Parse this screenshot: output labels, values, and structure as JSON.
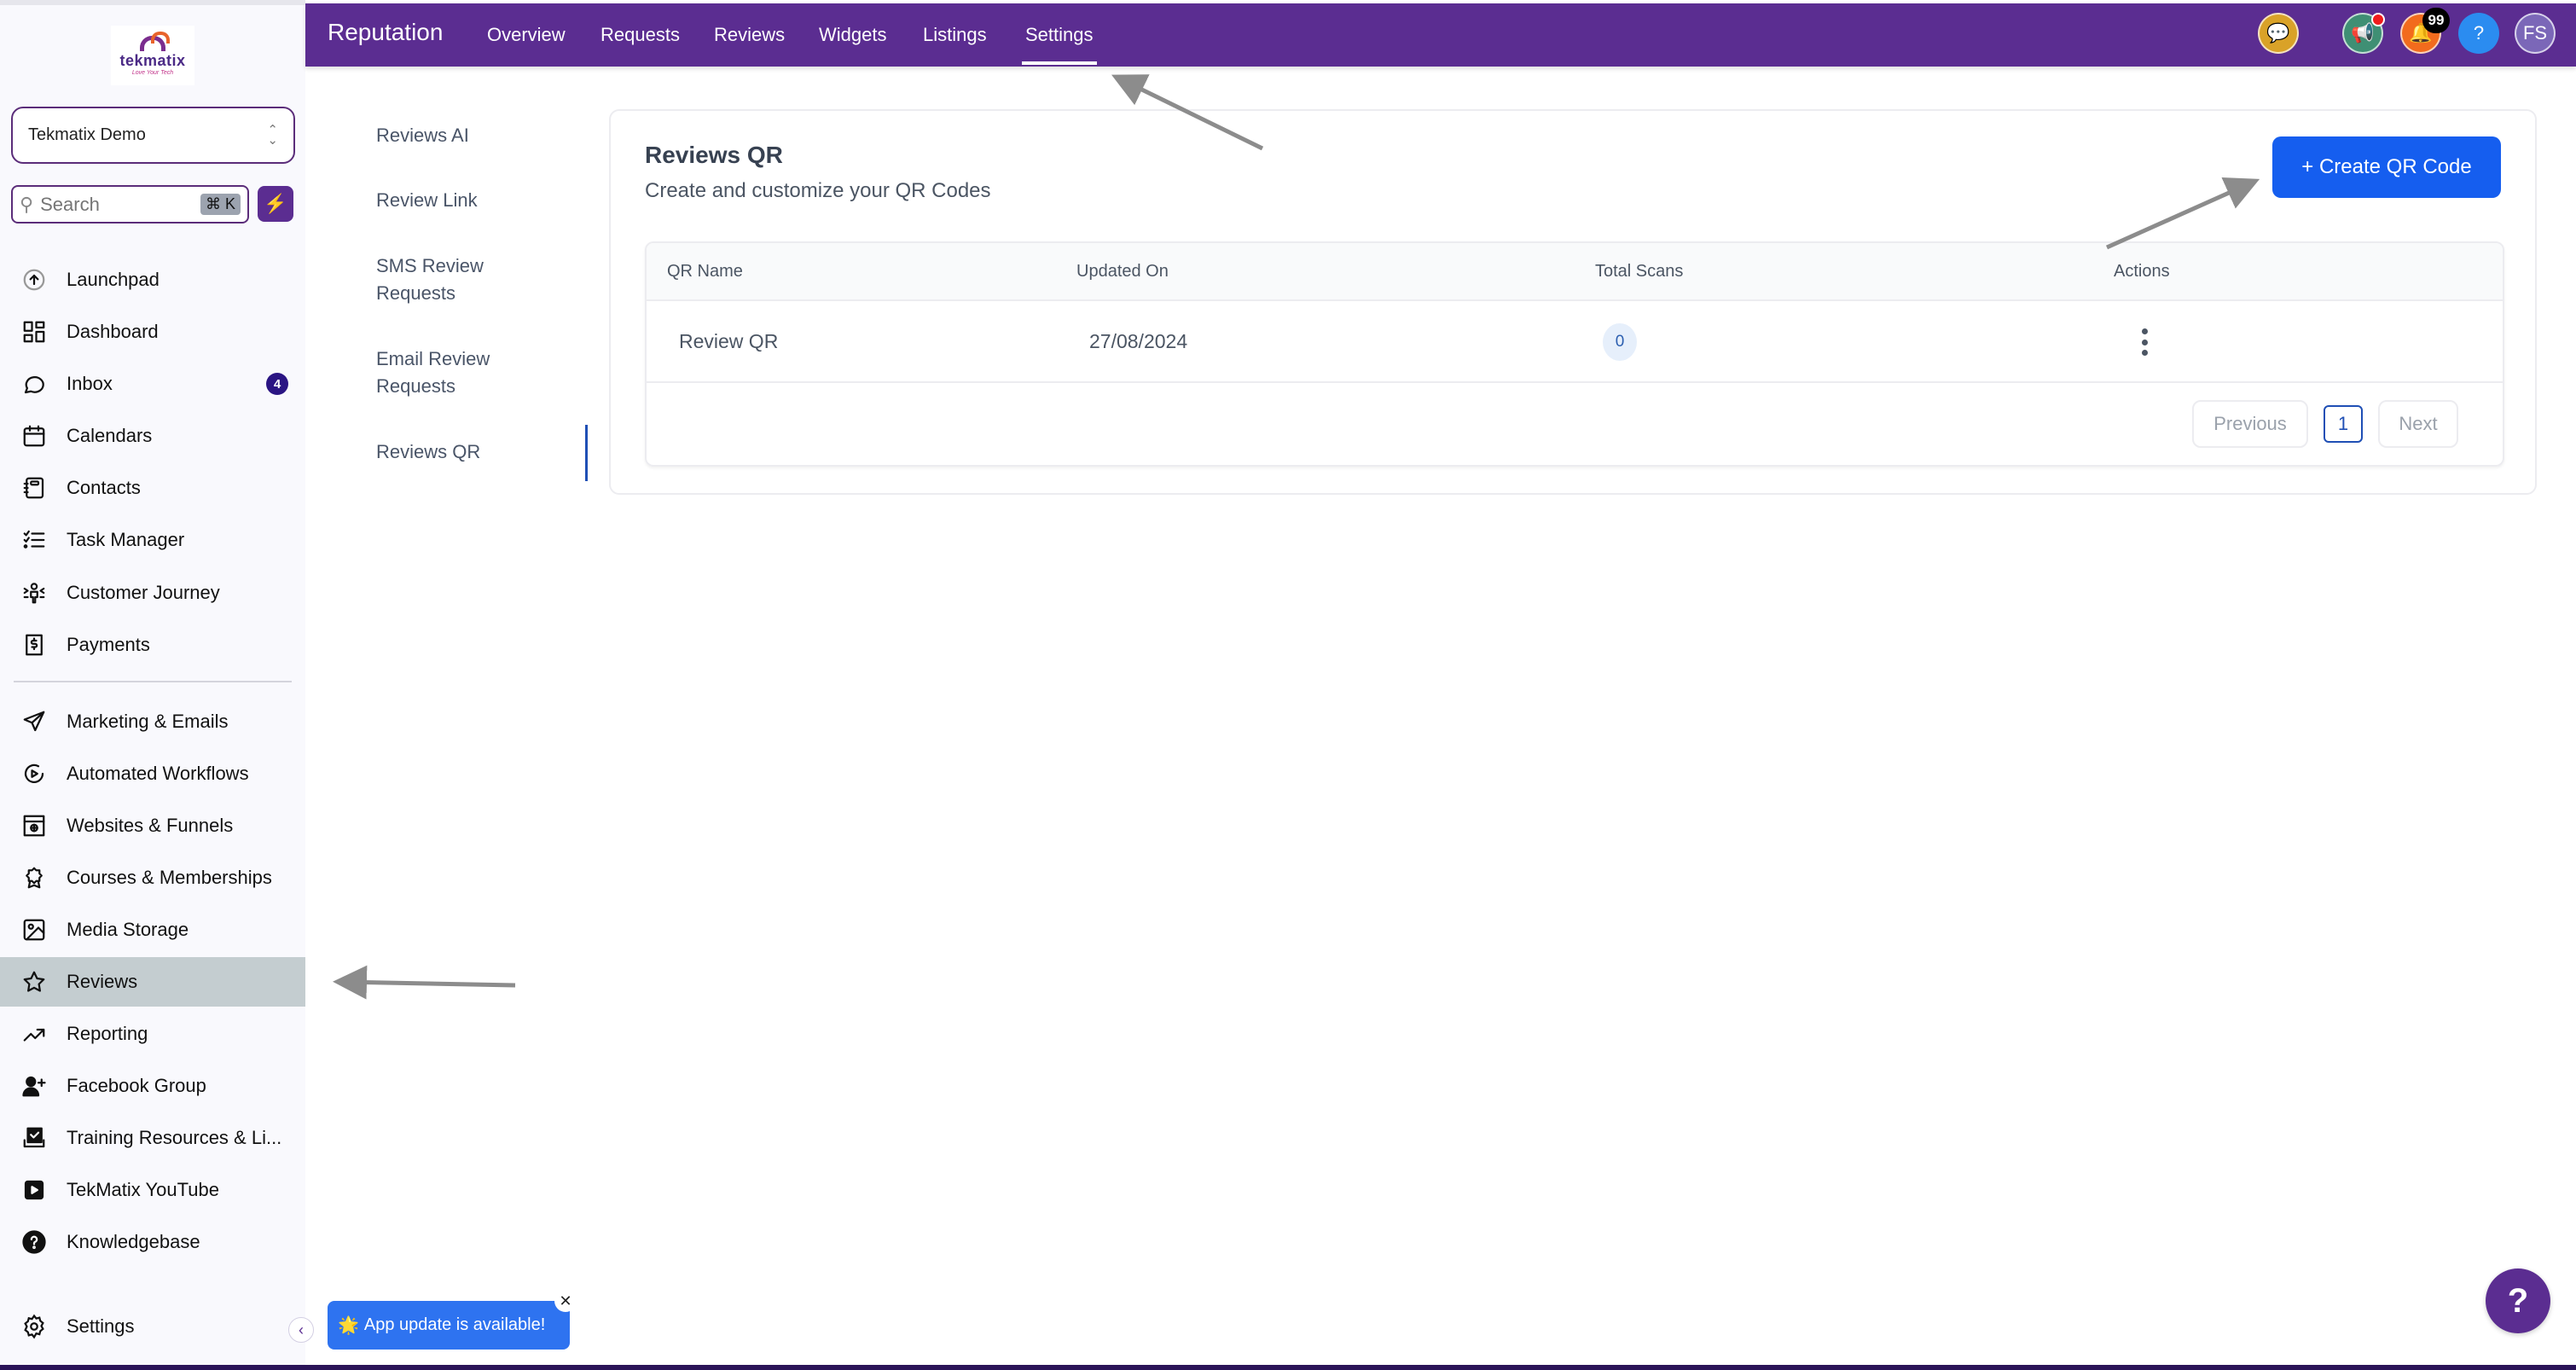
{
  "app": {
    "logo_word": "tekmatix",
    "logo_tagline": "Love Your Tech",
    "account_name": "Tekmatix Demo",
    "search_placeholder": "Search",
    "search_shortcut": "⌘ K"
  },
  "sidebar": {
    "items": [
      {
        "label": "Launchpad",
        "icon": "launchpad-icon"
      },
      {
        "label": "Dashboard",
        "icon": "dashboard-icon"
      },
      {
        "label": "Inbox",
        "icon": "chat-bubble-icon",
        "badge": "4"
      },
      {
        "label": "Calendars",
        "icon": "calendar-icon"
      },
      {
        "label": "Contacts",
        "icon": "contacts-book-icon"
      },
      {
        "label": "Task Manager",
        "icon": "task-list-icon"
      },
      {
        "label": "Customer Journey",
        "icon": "customer-journey-icon"
      },
      {
        "label": "Payments",
        "icon": "payments-receipt-icon"
      },
      {
        "label": "Marketing & Emails",
        "icon": "send-icon"
      },
      {
        "label": "Automated Workflows",
        "icon": "workflow-play-icon"
      },
      {
        "label": "Websites & Funnels",
        "icon": "website-icon"
      },
      {
        "label": "Courses & Memberships",
        "icon": "award-badge-icon"
      },
      {
        "label": "Media Storage",
        "icon": "image-icon"
      },
      {
        "label": "Reviews",
        "icon": "star-icon",
        "active": true
      },
      {
        "label": "Reporting",
        "icon": "trending-up-icon"
      },
      {
        "label": "Facebook Group",
        "icon": "user-plus-icon"
      },
      {
        "label": "Training Resources & Li...",
        "icon": "training-checkbox-icon"
      },
      {
        "label": "TekMatix YouTube",
        "icon": "youtube-icon"
      },
      {
        "label": "Knowledgebase",
        "icon": "question-circle-icon"
      }
    ],
    "settings_label": "Settings"
  },
  "topbar": {
    "title": "Reputation",
    "tabs": [
      "Overview",
      "Requests",
      "Reviews",
      "Widgets",
      "Listings",
      "Settings"
    ],
    "active_tab": "Settings",
    "notification_count": "99",
    "help_label": "?",
    "avatar_initials": "FS"
  },
  "settings_nav": {
    "items": [
      "Reviews AI",
      "Review Link",
      "SMS Review Requests",
      "Email Review Requests",
      "Reviews QR"
    ],
    "active": "Reviews QR"
  },
  "main": {
    "title": "Reviews QR",
    "subtitle": "Create and customize your QR Codes",
    "create_button": "+ Create QR Code",
    "table": {
      "columns": [
        "QR Name",
        "Updated On",
        "Total Scans",
        "Actions"
      ],
      "rows": [
        {
          "name": "Review QR",
          "updated_on": "27/08/2024",
          "total_scans": "0"
        }
      ]
    },
    "pagination": {
      "previous": "Previous",
      "current_page": "1",
      "next": "Next"
    }
  },
  "toast": {
    "icon": "🌟",
    "message": "App update is available!",
    "close": "✕"
  },
  "help_fab": "?",
  "colors": {
    "brand_purple": "#5b2d91",
    "primary_blue": "#155eef",
    "active_sidebar": "#c4cdd0"
  }
}
